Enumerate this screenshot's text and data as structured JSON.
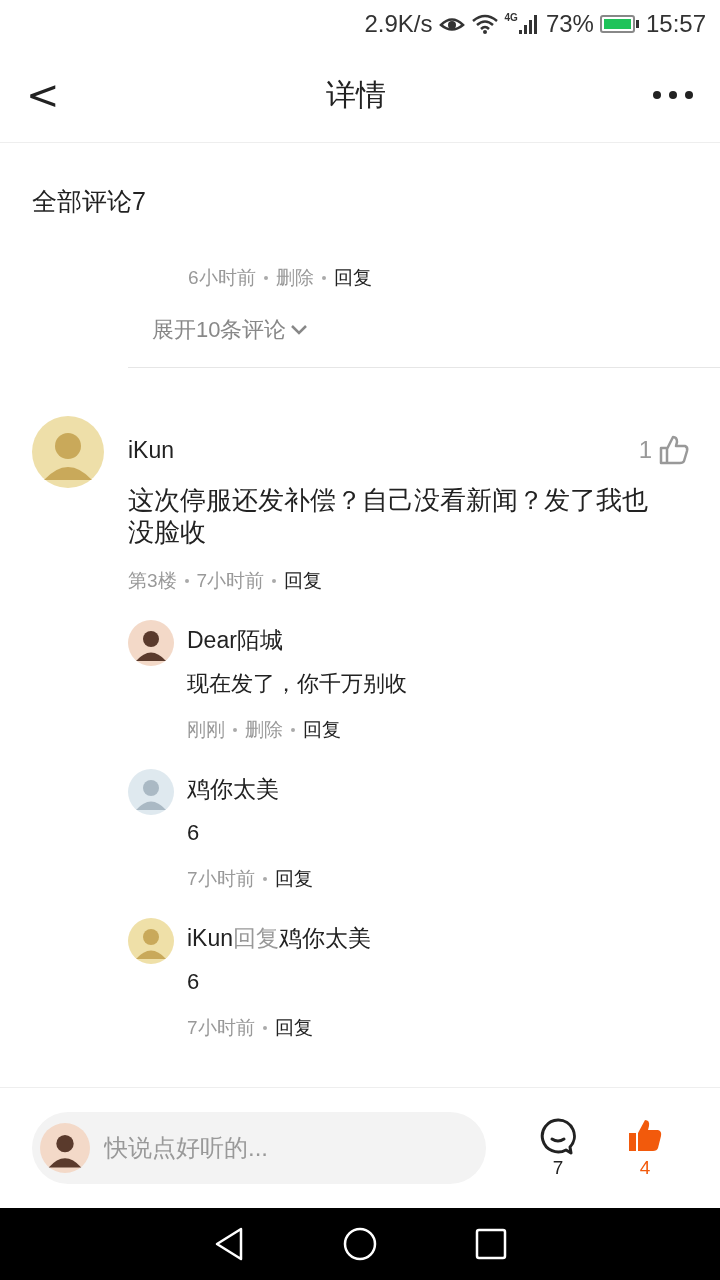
{
  "status_bar": {
    "speed": "2.9K/s",
    "network": "4G",
    "battery": "73%",
    "time": "15:57"
  },
  "header": {
    "back": "<",
    "title": "详情"
  },
  "comments_heading": "全部评论7",
  "previous_thread": {
    "meta": {
      "time": "6小时前",
      "delete": "删除",
      "reply": "回复"
    },
    "expand": "展开10条评论"
  },
  "comment": {
    "name": "iKun",
    "likes": "1",
    "text": "这次停服还发补偿？自己没看新闻？发了我也没脸收",
    "meta": {
      "floor": "第3楼",
      "time": "7小时前",
      "reply": "回复"
    },
    "replies": [
      {
        "name": "Dear陌城",
        "text": "现在发了，你千万别收",
        "meta": {
          "time": "刚刚",
          "delete": "删除",
          "reply": "回复"
        }
      },
      {
        "name": "鸡你太美",
        "text": "6",
        "meta": {
          "time": "7小时前",
          "reply": "回复"
        }
      },
      {
        "name": "iKun",
        "reply_word": "回复",
        "target": "鸡你太美",
        "text": "6",
        "meta": {
          "time": "7小时前",
          "reply": "回复"
        }
      }
    ]
  },
  "bottom_bar": {
    "placeholder": "快说点好听的...",
    "comment_count": "7",
    "like_count": "4",
    "liked": true
  }
}
